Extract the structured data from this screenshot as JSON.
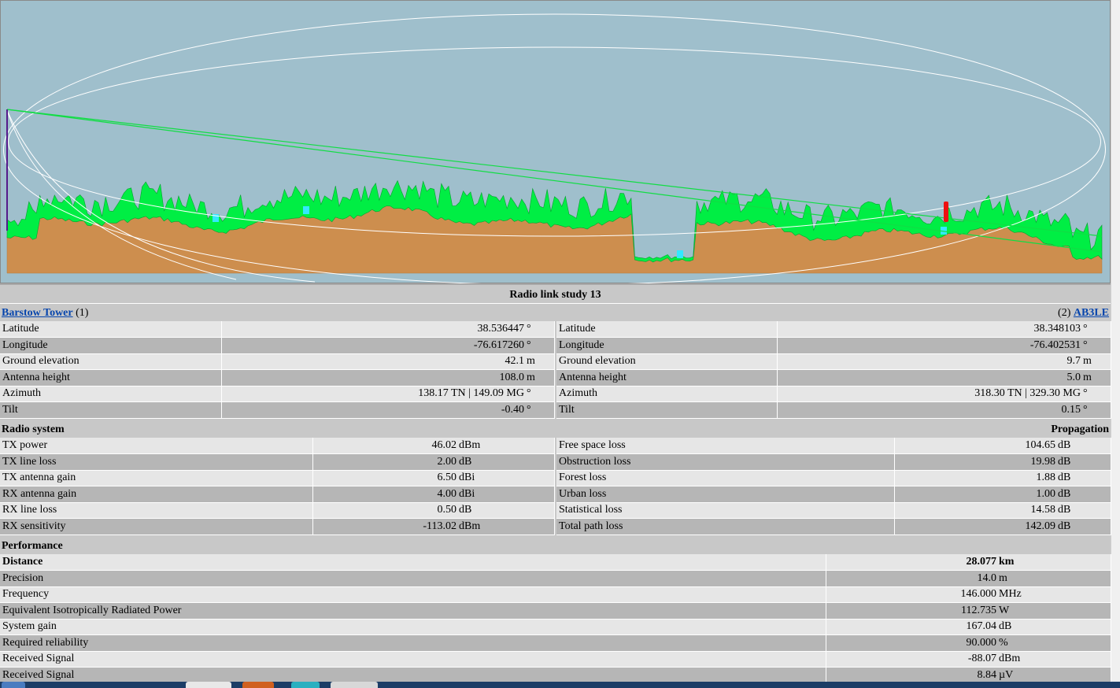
{
  "report": {
    "title": "Radio link study 13"
  },
  "site1": {
    "name": "Barstow Tower",
    "index": "(1)",
    "rows": [
      {
        "label": "Latitude",
        "value": "38.536447",
        "unit": "°"
      },
      {
        "label": "Longitude",
        "value": "-76.617260",
        "unit": "°"
      },
      {
        "label": "Ground elevation",
        "value": "42.1",
        "unit": "m"
      },
      {
        "label": "Antenna height",
        "value": "108.0",
        "unit": "m"
      },
      {
        "label": "Azimuth",
        "value": "138.17 TN | 149.09 MG",
        "unit": "°"
      },
      {
        "label": "Tilt",
        "value": "-0.40",
        "unit": "°"
      }
    ]
  },
  "site2": {
    "name": "AB3LE",
    "index": "(2)",
    "rows": [
      {
        "label": "Latitude",
        "value": "38.348103",
        "unit": "°"
      },
      {
        "label": "Longitude",
        "value": "-76.402531",
        "unit": "°"
      },
      {
        "label": "Ground elevation",
        "value": "9.7",
        "unit": "m"
      },
      {
        "label": "Antenna height",
        "value": "5.0",
        "unit": "m"
      },
      {
        "label": "Azimuth",
        "value": "318.30 TN | 329.30 MG",
        "unit": "°"
      },
      {
        "label": "Tilt",
        "value": "0.15",
        "unit": "°"
      }
    ]
  },
  "radio_system": {
    "heading": "Radio system",
    "rows": [
      {
        "label": "TX power",
        "value": "46.02",
        "unit": "dBm"
      },
      {
        "label": "TX line loss",
        "value": "2.00",
        "unit": "dB"
      },
      {
        "label": "TX antenna gain",
        "value": "6.50",
        "unit": "dBi"
      },
      {
        "label": "RX antenna gain",
        "value": "4.00",
        "unit": "dBi"
      },
      {
        "label": "RX line loss",
        "value": "0.50",
        "unit": "dB"
      },
      {
        "label": "RX sensitivity",
        "value": "-113.02",
        "unit": "dBm"
      }
    ]
  },
  "propagation": {
    "heading": "Propagation",
    "rows": [
      {
        "label": "Free space loss",
        "value": "104.65",
        "unit": "dB"
      },
      {
        "label": "Obstruction loss",
        "value": "19.98",
        "unit": "dB"
      },
      {
        "label": "Forest loss",
        "value": "1.88",
        "unit": "dB"
      },
      {
        "label": "Urban loss",
        "value": "1.00",
        "unit": "dB"
      },
      {
        "label": "Statistical loss",
        "value": "14.58",
        "unit": "dB"
      },
      {
        "label": "Total path loss",
        "value": "142.09",
        "unit": "dB"
      }
    ]
  },
  "performance": {
    "heading": "Performance",
    "rows": [
      {
        "label": "Distance",
        "value": "28.077",
        "unit": "km"
      },
      {
        "label": "Precision",
        "value": "14.0",
        "unit": "m"
      },
      {
        "label": "Frequency",
        "value": "146.000",
        "unit": "MHz"
      },
      {
        "label": "Equivalent Isotropically Radiated Power",
        "value": "112.735",
        "unit": "W"
      },
      {
        "label": "System gain",
        "value": "167.04",
        "unit": "dB"
      },
      {
        "label": "Required reliability",
        "value": "90.000",
        "unit": "%"
      },
      {
        "label": "Received Signal",
        "value": "-88.07",
        "unit": "dBm"
      },
      {
        "label": "Received Signal",
        "value": "8.84",
        "unit": "µV"
      }
    ]
  },
  "colors": {
    "sky": "#9fbfcc",
    "terrain": "#cd8e4e",
    "earth_curve": "#8b5638",
    "forest": "#00ee44",
    "forest_dark": "#0a8a2a",
    "water": "#33e8ff",
    "los_line": "#11dd44",
    "fresnel": "#ffffff",
    "tower": "#ee1111",
    "site_mast": "#551a8b"
  }
}
